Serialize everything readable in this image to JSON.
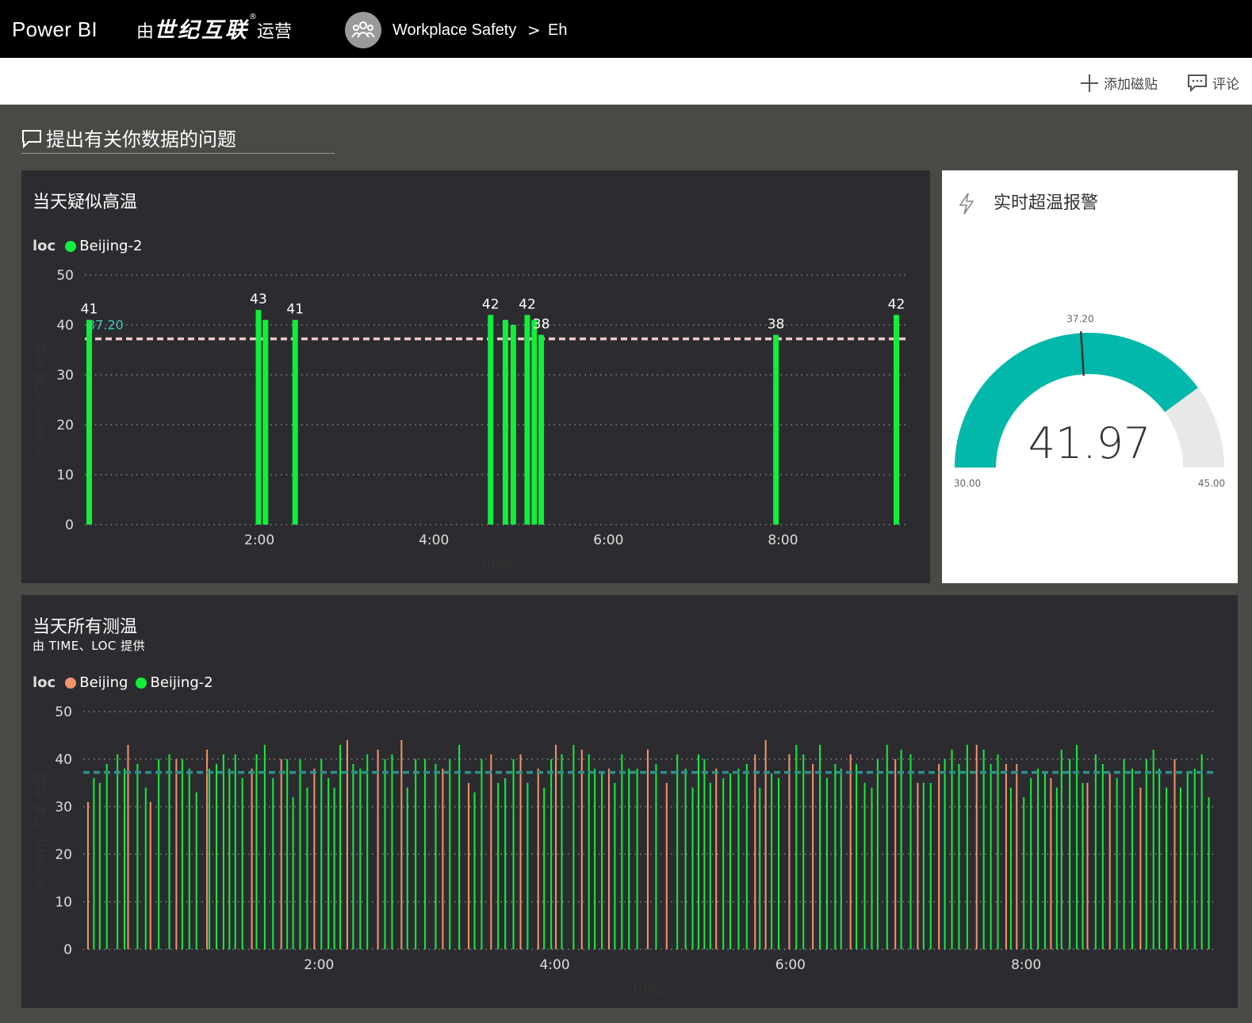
{
  "app": {
    "title": "Power BI",
    "operated_prefix": "由",
    "operated_brand": "世纪互联",
    "operated_reg": "®",
    "operated_suffix": "运营"
  },
  "breadcrumb": {
    "workspace": "Workplace Safety",
    "separator": ">",
    "item": "Eh"
  },
  "actions": {
    "add_tile": "添加磁贴",
    "comment": "评论"
  },
  "qna": {
    "placeholder": "提出有关你数据的问题"
  },
  "tiles": {
    "high_temp": {
      "title": "当天疑似高温",
      "legend_label": "loc",
      "legend": [
        "Beijing-2"
      ]
    },
    "gauge": {
      "title": "实时超温报警"
    },
    "all_temp": {
      "title": "当天所有测温",
      "subtitle": "由 TIME、LOC 提供",
      "legend_label": "loc",
      "legend": [
        "Beijing",
        "Beijing-2"
      ]
    }
  },
  "colors": {
    "beijing": "#f4956c",
    "beijing2": "#12ee3c",
    "gauge_fill": "#01b8aa",
    "gauge_bg": "#e8e8e8",
    "target_line_top": "#f2c9c9",
    "target_line_bottom": "#2f8f8a",
    "tile_bg": "#2c2c30",
    "canvas_bg": "#4a4946"
  },
  "icons": {
    "workspace": "people-group-icon",
    "add": "plus-icon",
    "comment": "speech-bubble-icon",
    "qna": "chat-bubble-icon",
    "gauge": "lightning-icon"
  },
  "chart_data": [
    {
      "id": "high_temp",
      "type": "bar",
      "title": "当天疑似高温",
      "xlabel": "time",
      "ylabel": "ir_temp 的最大值",
      "ylim": [
        0,
        50
      ],
      "yticks": [
        0,
        10,
        20,
        30,
        40,
        50
      ],
      "xlim": [
        0.0,
        9.45
      ],
      "xticks": [
        "2:00",
        "4:00",
        "6:00",
        "8:00"
      ],
      "grid": true,
      "target": 37.2,
      "target_label": "37.20",
      "series": [
        {
          "name": "Beijing-2",
          "points": [
            {
              "t": 0.05,
              "v": 41,
              "label": "41"
            },
            {
              "t": 1.99,
              "v": 43,
              "label": "43"
            },
            {
              "t": 2.07,
              "v": 41
            },
            {
              "t": 2.41,
              "v": 41,
              "label": "41"
            },
            {
              "t": 4.65,
              "v": 42,
              "label": "42"
            },
            {
              "t": 4.82,
              "v": 41
            },
            {
              "t": 4.91,
              "v": 40
            },
            {
              "t": 5.07,
              "v": 42,
              "label": "42"
            },
            {
              "t": 5.15,
              "v": 41
            },
            {
              "t": 5.23,
              "v": 38,
              "label": "38"
            },
            {
              "t": 7.92,
              "v": 38,
              "label": "38"
            },
            {
              "t": 9.3,
              "v": 42,
              "label": "42"
            }
          ]
        }
      ]
    },
    {
      "id": "gauge",
      "type": "gauge",
      "title": "实时超温报警",
      "value": 41.97,
      "value_label": "41.97",
      "min": 30,
      "max": 45,
      "min_label": "30.00",
      "max_label": "45.00",
      "target": 37.2,
      "target_label": "37.20"
    },
    {
      "id": "all_temp",
      "type": "bar",
      "title": "当天所有测温",
      "subtitle": "由 TIME、LOC 提供",
      "xlabel": "time",
      "ylabel": "ir_temp 的最大值",
      "ylim": [
        0,
        50
      ],
      "yticks": [
        0,
        10,
        20,
        30,
        40,
        50
      ],
      "xlim": [
        0.0,
        9.6
      ],
      "xticks": [
        "2:00",
        "4:00",
        "6:00",
        "8:00"
      ],
      "grid": true,
      "target": 37.2,
      "series": [
        {
          "name": "Beijing",
          "points": [
            [
              0.04,
              31
            ],
            [
              0.38,
              43
            ],
            [
              0.57,
              31
            ],
            [
              0.79,
              40
            ],
            [
              1.05,
              42
            ],
            [
              1.43,
              38
            ],
            [
              1.68,
              40
            ],
            [
              1.96,
              38
            ],
            [
              2.24,
              44
            ],
            [
              2.5,
              42
            ],
            [
              2.7,
              44
            ],
            [
              3.05,
              38
            ],
            [
              3.27,
              35
            ],
            [
              3.46,
              41
            ],
            [
              3.71,
              41
            ],
            [
              3.86,
              38
            ],
            [
              4.01,
              43
            ],
            [
              4.23,
              42
            ],
            [
              4.46,
              38
            ],
            [
              4.79,
              42
            ],
            [
              4.95,
              35
            ],
            [
              5.37,
              38
            ],
            [
              5.7,
              41
            ],
            [
              5.79,
              44
            ],
            [
              5.99,
              41
            ],
            [
              6.19,
              39
            ],
            [
              6.51,
              41
            ],
            [
              6.89,
              40
            ],
            [
              7.08,
              35
            ],
            [
              7.26,
              39
            ],
            [
              7.58,
              43
            ],
            [
              7.83,
              39
            ],
            [
              7.92,
              39
            ],
            [
              8.21,
              36
            ],
            [
              8.52,
              35
            ],
            [
              8.71,
              37
            ],
            [
              8.97,
              34
            ],
            [
              9.26,
              40
            ]
          ]
        },
        {
          "name": "Beijing-2",
          "points": [
            [
              0.09,
              36
            ],
            [
              0.14,
              35
            ],
            [
              0.2,
              39
            ],
            [
              0.29,
              41
            ],
            [
              0.35,
              38
            ],
            [
              0.46,
              39
            ],
            [
              0.53,
              34
            ],
            [
              0.64,
              40
            ],
            [
              0.73,
              41
            ],
            [
              0.84,
              40
            ],
            [
              0.9,
              38
            ],
            [
              0.96,
              33
            ],
            [
              1.07,
              38
            ],
            [
              1.13,
              39
            ],
            [
              1.19,
              41
            ],
            [
              1.24,
              38
            ],
            [
              1.29,
              41
            ],
            [
              1.35,
              36
            ],
            [
              1.47,
              41
            ],
            [
              1.54,
              43
            ],
            [
              1.61,
              36
            ],
            [
              1.73,
              40
            ],
            [
              1.78,
              32
            ],
            [
              1.84,
              40
            ],
            [
              1.9,
              34
            ],
            [
              2.02,
              40
            ],
            [
              2.08,
              36
            ],
            [
              2.13,
              34
            ],
            [
              2.18,
              43
            ],
            [
              2.29,
              39
            ],
            [
              2.35,
              38
            ],
            [
              2.41,
              41
            ],
            [
              2.56,
              40
            ],
            [
              2.62,
              41
            ],
            [
              2.75,
              34
            ],
            [
              2.82,
              40
            ],
            [
              2.9,
              40
            ],
            [
              2.99,
              39
            ],
            [
              3.11,
              40
            ],
            [
              3.19,
              43
            ],
            [
              3.32,
              33
            ],
            [
              3.38,
              40
            ],
            [
              3.52,
              35
            ],
            [
              3.58,
              36
            ],
            [
              3.65,
              40
            ],
            [
              3.77,
              35
            ],
            [
              3.91,
              34
            ],
            [
              3.97,
              40
            ],
            [
              4.06,
              41
            ],
            [
              4.16,
              43
            ],
            [
              4.29,
              41
            ],
            [
              4.34,
              38
            ],
            [
              4.4,
              37
            ],
            [
              4.51,
              35
            ],
            [
              4.57,
              41
            ],
            [
              4.63,
              38
            ],
            [
              4.7,
              38
            ],
            [
              4.86,
              39
            ],
            [
              5.04,
              41
            ],
            [
              5.11,
              38
            ],
            [
              5.17,
              34
            ],
            [
              5.22,
              41
            ],
            [
              5.27,
              40
            ],
            [
              5.32,
              35
            ],
            [
              5.43,
              36
            ],
            [
              5.49,
              37
            ],
            [
              5.56,
              38
            ],
            [
              5.63,
              39
            ],
            [
              5.74,
              34
            ],
            [
              5.84,
              37
            ],
            [
              5.9,
              36
            ],
            [
              6.05,
              43
            ],
            [
              6.11,
              41
            ],
            [
              6.25,
              43
            ],
            [
              6.31,
              36
            ],
            [
              6.38,
              39
            ],
            [
              6.43,
              38
            ],
            [
              6.56,
              39
            ],
            [
              6.63,
              35
            ],
            [
              6.69,
              34
            ],
            [
              6.74,
              40
            ],
            [
              6.82,
              43
            ],
            [
              6.94,
              42
            ],
            [
              7.02,
              41
            ],
            [
              7.13,
              35
            ],
            [
              7.19,
              35
            ],
            [
              7.31,
              40
            ],
            [
              7.37,
              42
            ],
            [
              7.43,
              39
            ],
            [
              7.5,
              43
            ],
            [
              7.64,
              42
            ],
            [
              7.7,
              39
            ],
            [
              7.76,
              41
            ],
            [
              7.87,
              34
            ],
            [
              7.98,
              32
            ],
            [
              8.04,
              36
            ],
            [
              8.1,
              38
            ],
            [
              8.16,
              37
            ],
            [
              8.26,
              34
            ],
            [
              8.3,
              42
            ],
            [
              8.37,
              40
            ],
            [
              8.43,
              43
            ],
            [
              8.48,
              35
            ],
            [
              8.59,
              41
            ],
            [
              8.65,
              39
            ],
            [
              8.77,
              36
            ],
            [
              8.83,
              40
            ],
            [
              8.9,
              38
            ],
            [
              9.02,
              40
            ],
            [
              9.08,
              42
            ],
            [
              9.13,
              38
            ],
            [
              9.19,
              34
            ],
            [
              9.31,
              34
            ],
            [
              9.37,
              37
            ],
            [
              9.43,
              38
            ],
            [
              9.49,
              41
            ],
            [
              9.55,
              32
            ]
          ]
        }
      ]
    }
  ]
}
